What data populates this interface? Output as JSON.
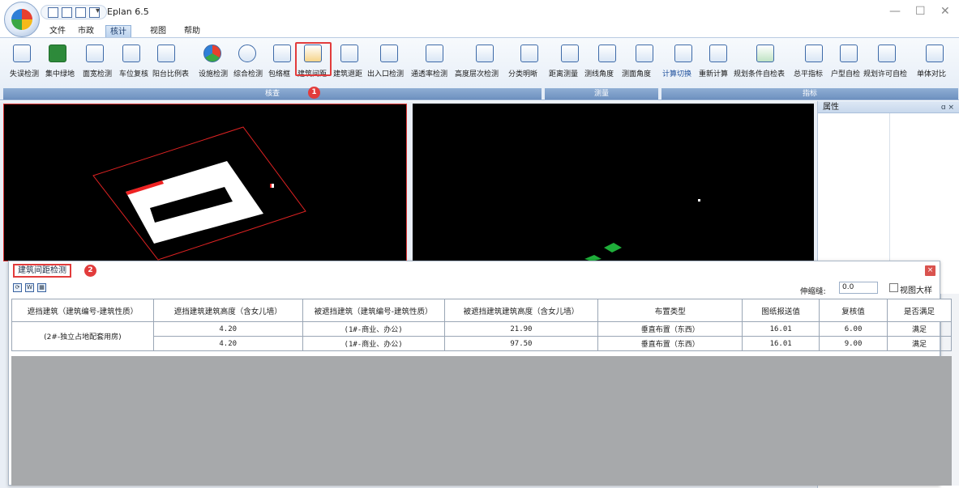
{
  "app": {
    "title": "Eplan 6.5"
  },
  "menus": [
    "文件",
    "市政",
    "核计",
    "视图",
    "帮助"
  ],
  "ribbon": {
    "tools": [
      "失误检测",
      "集中绿地",
      "面宽检测",
      "车位复核",
      "阳台比例表",
      "设施检测",
      "综合检测",
      "包络框",
      "建筑间距",
      "建筑退距",
      "出入口检测",
      "通透率检测",
      "高度层次检测",
      "分类明晰",
      "距离测量",
      "测线角度",
      "测面角度",
      "计算切换",
      "重新计算",
      "规划条件自检表",
      "总平指标",
      "户型自检",
      "规划许可自检",
      "单体对比"
    ],
    "groups": [
      "核查",
      "测量",
      "指标"
    ],
    "badge1": "1"
  },
  "props": {
    "title": "属性",
    "pin": "ɑ ×"
  },
  "panel": {
    "title": "建筑间距检测",
    "badge2": "2",
    "close": "×",
    "shrink_label": "伸缩缝:",
    "shrink_value": "0.0",
    "zoom_label": "视图大样",
    "headers": [
      "遮挡建筑（建筑编号-建筑性质）",
      "遮挡建筑建筑高度（含女儿墙）",
      "被遮挡建筑（建筑编号-建筑性质）",
      "被遮挡建筑建筑高度（含女儿墙）",
      "布置类型",
      "图纸报送值",
      "复核值",
      "是否满足"
    ],
    "rows": [
      {
        "blocker": "(2#-独立占地配套用房)",
        "h1": "4.20",
        "blocked": "(1#-商业、办公)",
        "h2": "21.90",
        "type": "垂直布置（东西）",
        "report": "16.01",
        "check": "6.00",
        "ok": "满足"
      },
      {
        "h1": "4.20",
        "blocked": "(1#-商业、办公)",
        "h2": "97.50",
        "type": "垂直布置（东西）",
        "report": "16.01",
        "check": "9.00",
        "ok": "满足"
      }
    ]
  }
}
